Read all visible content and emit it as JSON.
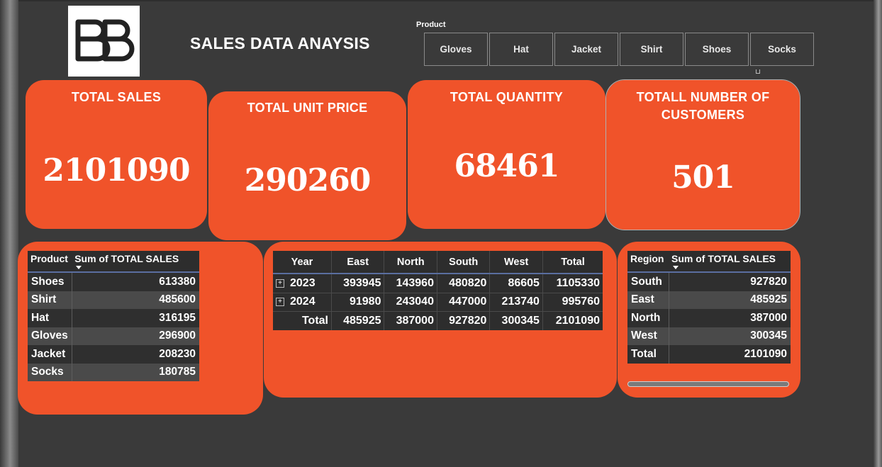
{
  "header": {
    "title": "SALES DATA ANAYSIS",
    "slicer_label": "Product",
    "slicer_items": [
      "Gloves",
      "Hat",
      "Jacket",
      "Shirt",
      "Shoes",
      "Socks"
    ]
  },
  "kpis": [
    {
      "title": "TOTAL SALES",
      "value": "2101090"
    },
    {
      "title": "TOTAL UNIT PRICE",
      "value": "290260"
    },
    {
      "title": "TOTAL QUANTITY",
      "value": "68461"
    },
    {
      "title_line1": "TOTALL NUMBER OF",
      "title_line2": "CUSTOMERS",
      "value": "501"
    }
  ],
  "product_table": {
    "headers": [
      "Product",
      "Sum of TOTAL SALES"
    ],
    "rows": [
      {
        "label": "Shoes",
        "value": "613380"
      },
      {
        "label": "Shirt",
        "value": "485600"
      },
      {
        "label": "Hat",
        "value": "316195"
      },
      {
        "label": "Gloves",
        "value": "296900"
      },
      {
        "label": "Jacket",
        "value": "208230"
      },
      {
        "label": "Socks",
        "value": "180785"
      }
    ]
  },
  "year_matrix": {
    "headers": [
      "Year",
      "East",
      "North",
      "South",
      "West",
      "Total"
    ],
    "expand_glyph": "+",
    "rows": [
      {
        "year": "2023",
        "values": [
          "393945",
          "143960",
          "480820",
          "86605",
          "1105330"
        ]
      },
      {
        "year": "2024",
        "values": [
          "91980",
          "243040",
          "447000",
          "213740",
          "995760"
        ]
      }
    ],
    "total": {
      "label": "Total",
      "values": [
        "485925",
        "387000",
        "927820",
        "300345",
        "2101090"
      ]
    }
  },
  "region_table": {
    "headers": [
      "Region",
      "Sum of TOTAL SALES"
    ],
    "rows": [
      {
        "label": "South",
        "value": "927820"
      },
      {
        "label": "East",
        "value": "485925"
      },
      {
        "label": "North",
        "value": "387000"
      },
      {
        "label": "West",
        "value": "300345"
      },
      {
        "label": "Total",
        "value": "2101090"
      }
    ]
  },
  "colors": {
    "accent": "#f0532a",
    "background": "#3a3a3a",
    "table_header": "#2d2d2d"
  }
}
